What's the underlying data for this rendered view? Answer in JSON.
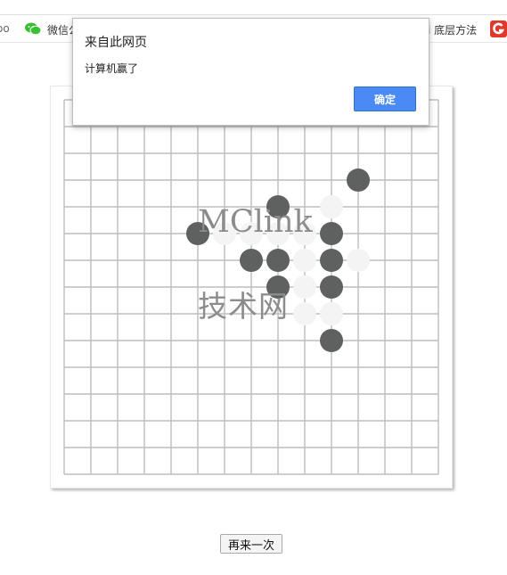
{
  "bookmarks": {
    "cut_label": "oo",
    "wechat_label": "微信公",
    "bottom_label": "i 底层方法",
    "icons": [
      "wechat-icon",
      "g-logo-icon"
    ],
    "g_color": "#e0382b",
    "wechat_color": "#3bbf35"
  },
  "dialog": {
    "title": "来自此网页",
    "message": "计算机赢了",
    "ok_label": "确定"
  },
  "watermark": {
    "line1": "MClink",
    "line2": "技术网"
  },
  "board": {
    "size": 15,
    "colors": {
      "line": "#bdbdbd",
      "black": "#5f6160",
      "white": "#f4f4f4"
    },
    "stones": [
      {
        "c": 11,
        "r": 3,
        "color": "black"
      },
      {
        "c": 8,
        "r": 4,
        "color": "black"
      },
      {
        "c": 10,
        "r": 4,
        "color": "white"
      },
      {
        "c": 5,
        "r": 5,
        "color": "black"
      },
      {
        "c": 6,
        "r": 5,
        "color": "white"
      },
      {
        "c": 7,
        "r": 5,
        "color": "white"
      },
      {
        "c": 8,
        "r": 5,
        "color": "white"
      },
      {
        "c": 9,
        "r": 5,
        "color": "white"
      },
      {
        "c": 10,
        "r": 5,
        "color": "black"
      },
      {
        "c": 7,
        "r": 6,
        "color": "black"
      },
      {
        "c": 8,
        "r": 6,
        "color": "black"
      },
      {
        "c": 9,
        "r": 6,
        "color": "white"
      },
      {
        "c": 10,
        "r": 6,
        "color": "black"
      },
      {
        "c": 11,
        "r": 6,
        "color": "white"
      },
      {
        "c": 8,
        "r": 7,
        "color": "black"
      },
      {
        "c": 9,
        "r": 7,
        "color": "white"
      },
      {
        "c": 10,
        "r": 7,
        "color": "black"
      },
      {
        "c": 9,
        "r": 8,
        "color": "white"
      },
      {
        "c": 10,
        "r": 8,
        "color": "white"
      },
      {
        "c": 10,
        "r": 9,
        "color": "black"
      }
    ]
  },
  "restart_label": "再来一次"
}
